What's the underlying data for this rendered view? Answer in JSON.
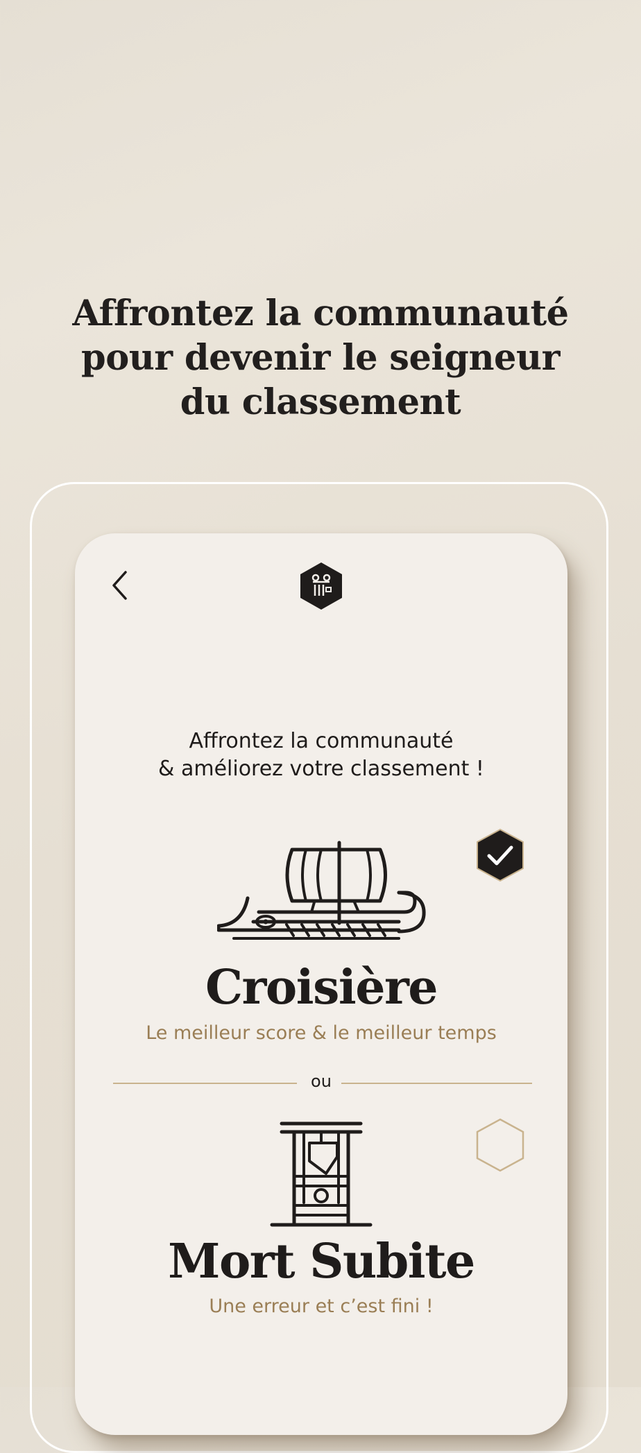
{
  "headline": {
    "line1": "Affrontez la communauté",
    "line2": "pour devenir le seigneur",
    "line3": "du classement"
  },
  "screen": {
    "back_icon": "chevron-left-icon",
    "logo_icon": "column-hexagon-logo-icon",
    "subtitle": {
      "line1": "Affrontez la communauté",
      "line2": "& améliorez votre classement !"
    },
    "modes": [
      {
        "title": "Croisière",
        "description": "Le meilleur score & le meilleur temps",
        "icon": "galley-ship-icon",
        "selected": true
      },
      {
        "title": "Mort Subite",
        "description": "Une erreur et c’est fini !",
        "icon": "guillotine-icon",
        "selected": false
      }
    ],
    "separator_label": "ou"
  },
  "colors": {
    "background": "#e6dfd3",
    "card": "#f3efea",
    "ink": "#1f1c1b",
    "accent_gold": "#9a7e55",
    "line_gold": "#c9b38e"
  }
}
